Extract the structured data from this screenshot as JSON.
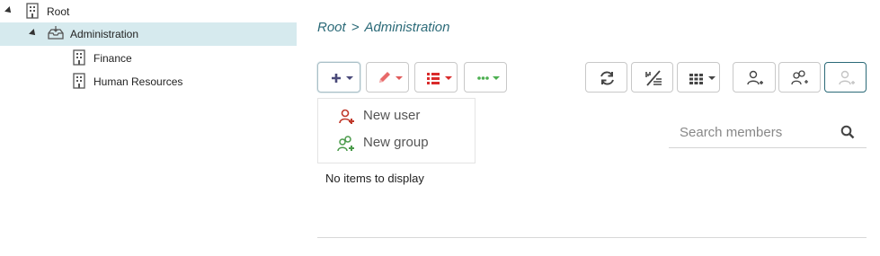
{
  "tree": {
    "root": {
      "label": "Root",
      "expanded": true
    },
    "administration": {
      "label": "Administration",
      "expanded": true,
      "selected": true
    },
    "finance": {
      "label": "Finance"
    },
    "human_resources": {
      "label": "Human Resources"
    }
  },
  "breadcrumb": {
    "root": "Root",
    "separator": ">",
    "current": "Administration"
  },
  "toolbar": {
    "add": {
      "icon": "plus-icon",
      "color": "#4a4a7a"
    },
    "edit": {
      "icon": "pencil-icon",
      "color": "#e05a5a"
    },
    "list": {
      "icon": "list-icon",
      "color": "#d92b2b"
    },
    "more": {
      "icon": "ellipsis-icon",
      "color": "#4caf50"
    },
    "refresh": {
      "icon": "refresh-icon"
    },
    "filter": {
      "icon": "percent-filter-icon"
    },
    "columns": {
      "icon": "grid-icon"
    },
    "add_user": {
      "icon": "user-plus-icon"
    },
    "add_group": {
      "icon": "group-plus-icon"
    },
    "add_member": {
      "icon": "user-plus-disabled-icon"
    }
  },
  "add_menu": {
    "new_user": "New user",
    "new_group": "New group"
  },
  "search": {
    "placeholder": "Search members"
  },
  "content": {
    "empty_text": "No items to display"
  },
  "colors": {
    "accent": "#2b6a78",
    "selected_row": "#d6eaee"
  }
}
